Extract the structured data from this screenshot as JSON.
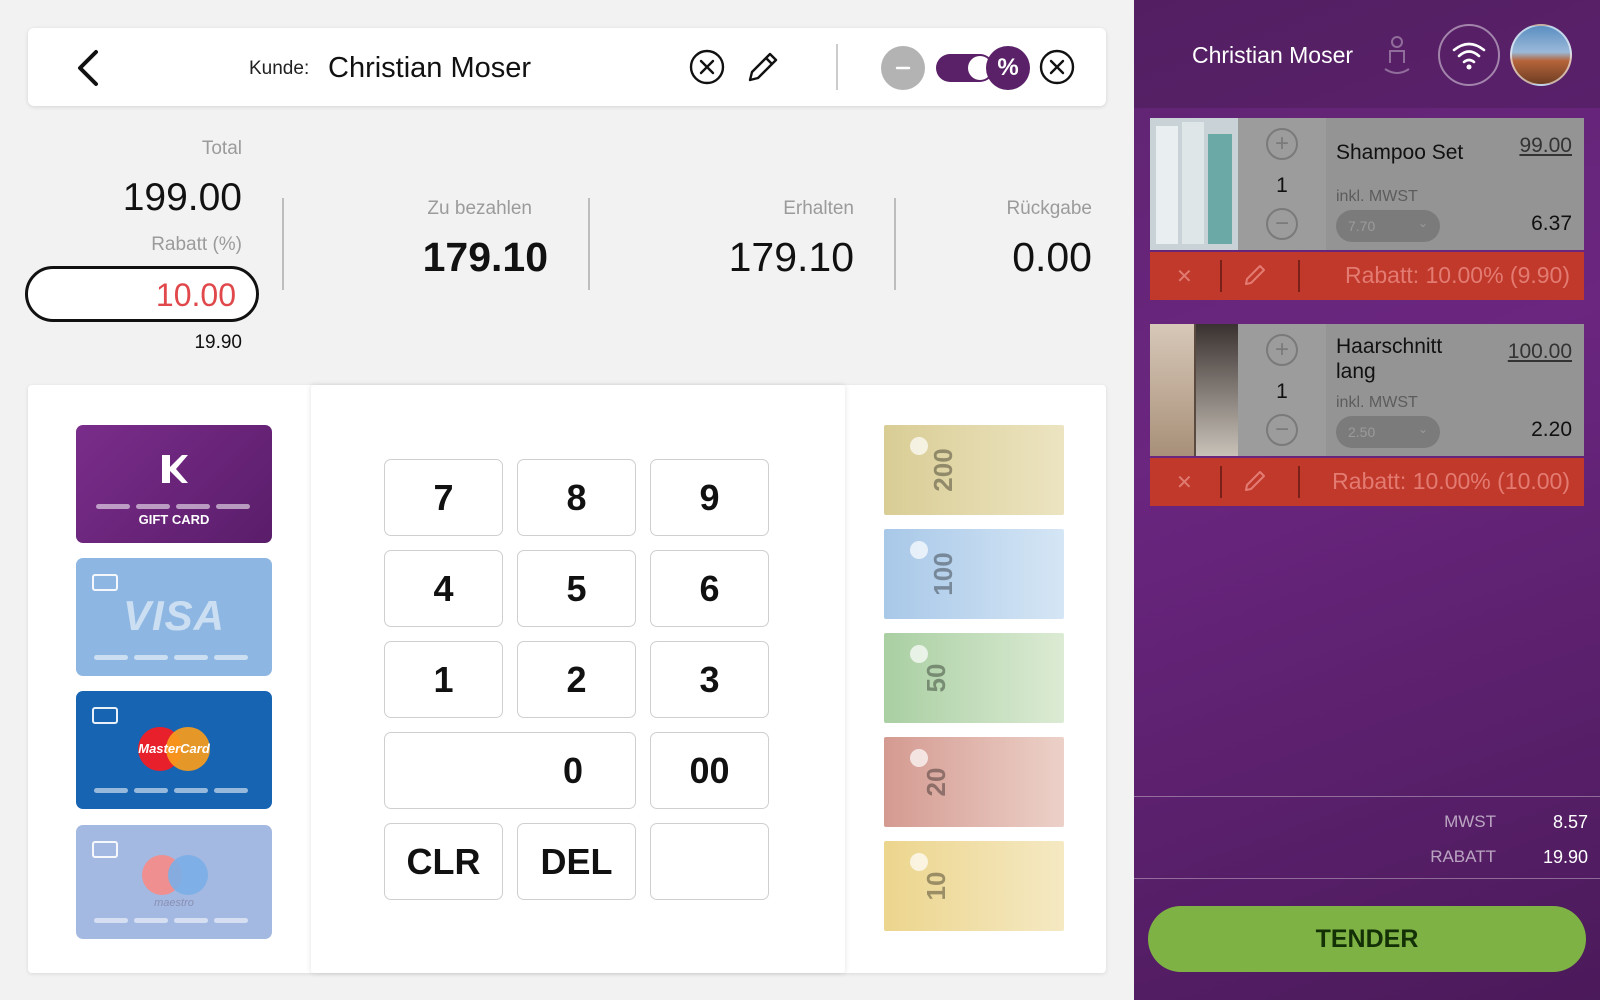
{
  "header": {
    "customer_label": "Kunde:",
    "customer_name": "Christian Moser",
    "discount_button": "%"
  },
  "totals": {
    "total_label": "Total",
    "total_value": "199.00",
    "rabatt_label": "Rabatt (%)",
    "rabatt_input": "10.00",
    "rabatt_amount": "19.90",
    "zu_bezahlen_label": "Zu bezahlen",
    "zu_bezahlen_value": "179.10",
    "erhalten_label": "Erhalten",
    "erhalten_value": "179.10",
    "rueckgabe_label": "Rückgabe",
    "rueckgabe_value": "0.00"
  },
  "cards": {
    "gift_label": "GIFT CARD",
    "visa_label": "VISA",
    "mastercard_label": "MasterCard",
    "maestro_label": "maestro"
  },
  "keypad": {
    "k7": "7",
    "k8": "8",
    "k9": "9",
    "k4": "4",
    "k5": "5",
    "k6": "6",
    "k1": "1",
    "k2": "2",
    "k3": "3",
    "k0": "0",
    "k00": "00",
    "clr": "CLR",
    "del": "DEL",
    "blank": ""
  },
  "banknotes": {
    "n200": "200",
    "n100": "100",
    "n50": "50",
    "n20": "20",
    "n10": "10"
  },
  "sidebar": {
    "user_name": "Christian Moser",
    "items": [
      {
        "qty": "1",
        "name": "Shampoo Set",
        "price": "99.00",
        "mwst_label": "inkl. MWST",
        "mwst_rate": "7.70",
        "mwst_value": "6.37",
        "discount": "Rabatt: 10.00% (9.90)"
      },
      {
        "qty": "1",
        "name": "Haarschnitt lang",
        "price": "100.00",
        "mwst_label": "inkl. MWST",
        "mwst_rate": "2.50",
        "mwst_value": "2.20",
        "discount": "Rabatt: 10.00% (10.00)"
      }
    ],
    "summary": {
      "mwst_label": "MWST",
      "mwst_value": "8.57",
      "rabatt_label": "RABATT",
      "rabatt_value": "19.90"
    },
    "tender_label": "TENDER"
  },
  "colors": {
    "brand_purple": "#5b2168",
    "discount_red": "#c0392b",
    "tender_green": "#7fb244"
  },
  "icons": [
    "back-chevron-icon",
    "clear-circle-icon",
    "pencil-icon",
    "toggle-switch",
    "percent-icon",
    "close-circle-icon",
    "person-icon",
    "wifi-icon",
    "avatar",
    "plus-circle-icon",
    "minus-circle-icon",
    "close-icon"
  ]
}
